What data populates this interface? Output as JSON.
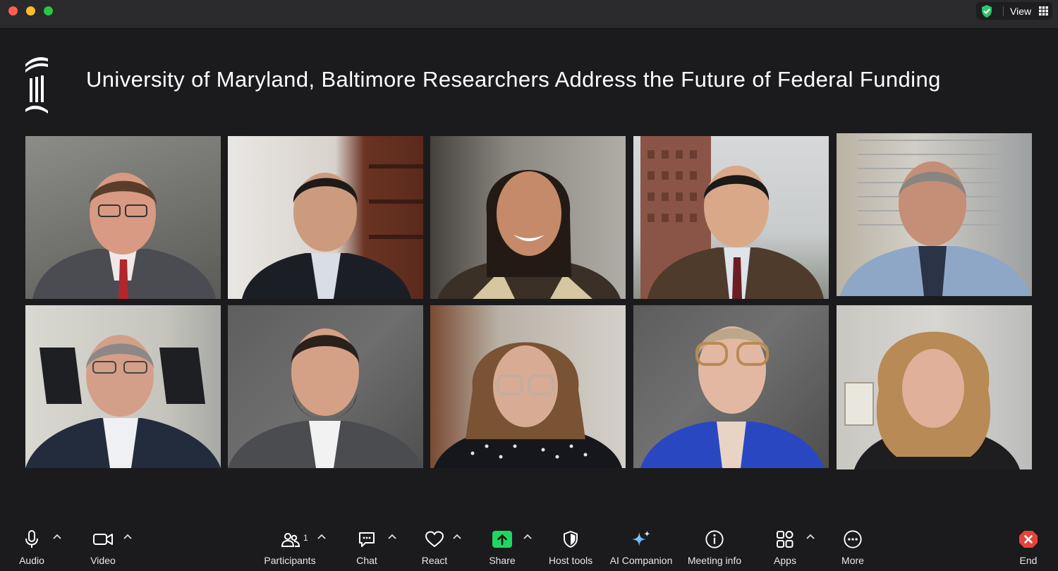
{
  "window": {
    "view_label": "View",
    "icons": {
      "security": "shield-check-icon",
      "view": "grid-icon"
    }
  },
  "meeting": {
    "headline": "University of Maryland, Baltimore Researchers Address the Future of Federal Funding",
    "logo": "umb-column-logo",
    "participants_tiles": 10
  },
  "toolbar": {
    "audio": "Audio",
    "video": "Video",
    "participants": "Participants",
    "participants_count": "1",
    "chat": "Chat",
    "react": "React",
    "share": "Share",
    "host_tools": "Host tools",
    "ai_companion": "AI Companion",
    "meeting_info": "Meeting info",
    "apps": "Apps",
    "more": "More",
    "end": "End"
  },
  "colors": {
    "background": "#1b1b1d",
    "share_green": "#1ed760",
    "end_red": "#e5443b",
    "security_green": "#2ec46b"
  }
}
